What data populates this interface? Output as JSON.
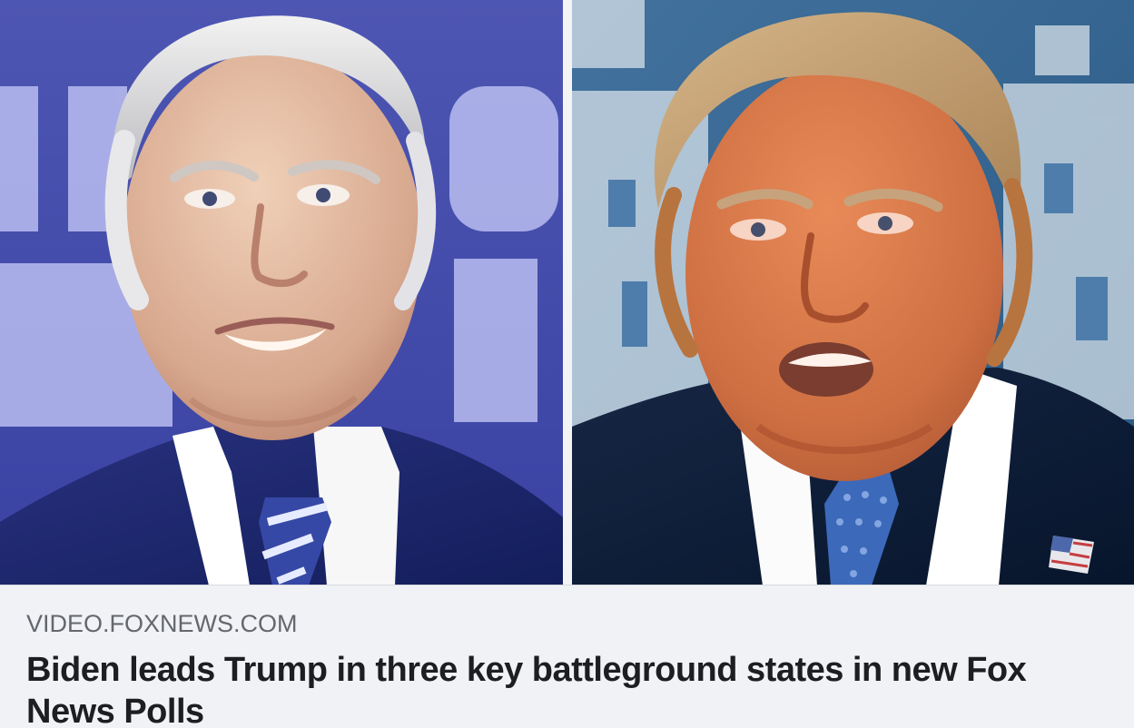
{
  "link_preview": {
    "image": {
      "left_photo": "portrait-photo-left",
      "right_photo": "portrait-photo-right"
    },
    "source_domain": "VIDEO.FOXNEWS.COM",
    "headline": "Biden leads Trump in three key battleground states in new Fox News Polls"
  },
  "colors": {
    "caption_background": "#f1f2f5",
    "domain_text": "#64676d",
    "headline_text": "#1c1e21"
  }
}
